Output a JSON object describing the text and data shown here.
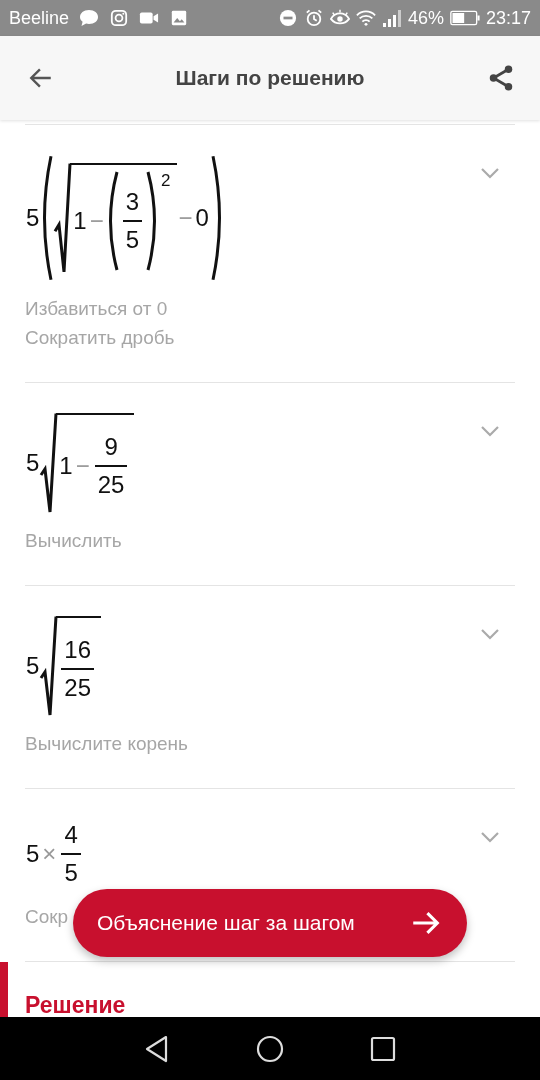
{
  "status_bar": {
    "carrier": "Beeline",
    "battery": "46%",
    "time": "23:17"
  },
  "app_bar": {
    "title": "Шаги по решению"
  },
  "steps": [
    {
      "expanded": false,
      "expression": [
        {
          "kind": "num",
          "text": "5"
        },
        {
          "kind": "paren",
          "children": [
            {
              "kind": "sqrt",
              "children": [
                {
                  "kind": "num",
                  "text": "1"
                },
                {
                  "kind": "op",
                  "text": "−"
                },
                {
                  "kind": "paren",
                  "sup": "2",
                  "children": [
                    {
                      "kind": "frac",
                      "num": "3",
                      "den": "5"
                    }
                  ]
                }
              ]
            },
            {
              "kind": "op",
              "text": "−"
            },
            {
              "kind": "num",
              "text": "0"
            }
          ]
        }
      ],
      "descriptions": [
        "Избавиться от 0",
        "Сократить дробь"
      ]
    },
    {
      "expanded": false,
      "expression": [
        {
          "kind": "num",
          "text": "5"
        },
        {
          "kind": "sqrt",
          "children": [
            {
              "kind": "num",
              "text": "1"
            },
            {
              "kind": "op",
              "text": "−"
            },
            {
              "kind": "frac",
              "num": "9",
              "den": "25"
            }
          ]
        }
      ],
      "descriptions": [
        "Вычислить"
      ]
    },
    {
      "expanded": false,
      "expression": [
        {
          "kind": "num",
          "text": "5"
        },
        {
          "kind": "sqrt",
          "children": [
            {
              "kind": "frac",
              "num": "16",
              "den": "25"
            }
          ]
        }
      ],
      "descriptions": [
        "Вычислите корень"
      ]
    },
    {
      "expanded": false,
      "expression": [
        {
          "kind": "num",
          "text": "5"
        },
        {
          "kind": "op",
          "text": "×"
        },
        {
          "kind": "frac",
          "num": "4",
          "den": "5"
        }
      ],
      "descriptions": [
        "Сокр"
      ]
    }
  ],
  "floating_button": {
    "label": "Объяснение шаг за шагом"
  },
  "section": {
    "title": "Решение"
  }
}
